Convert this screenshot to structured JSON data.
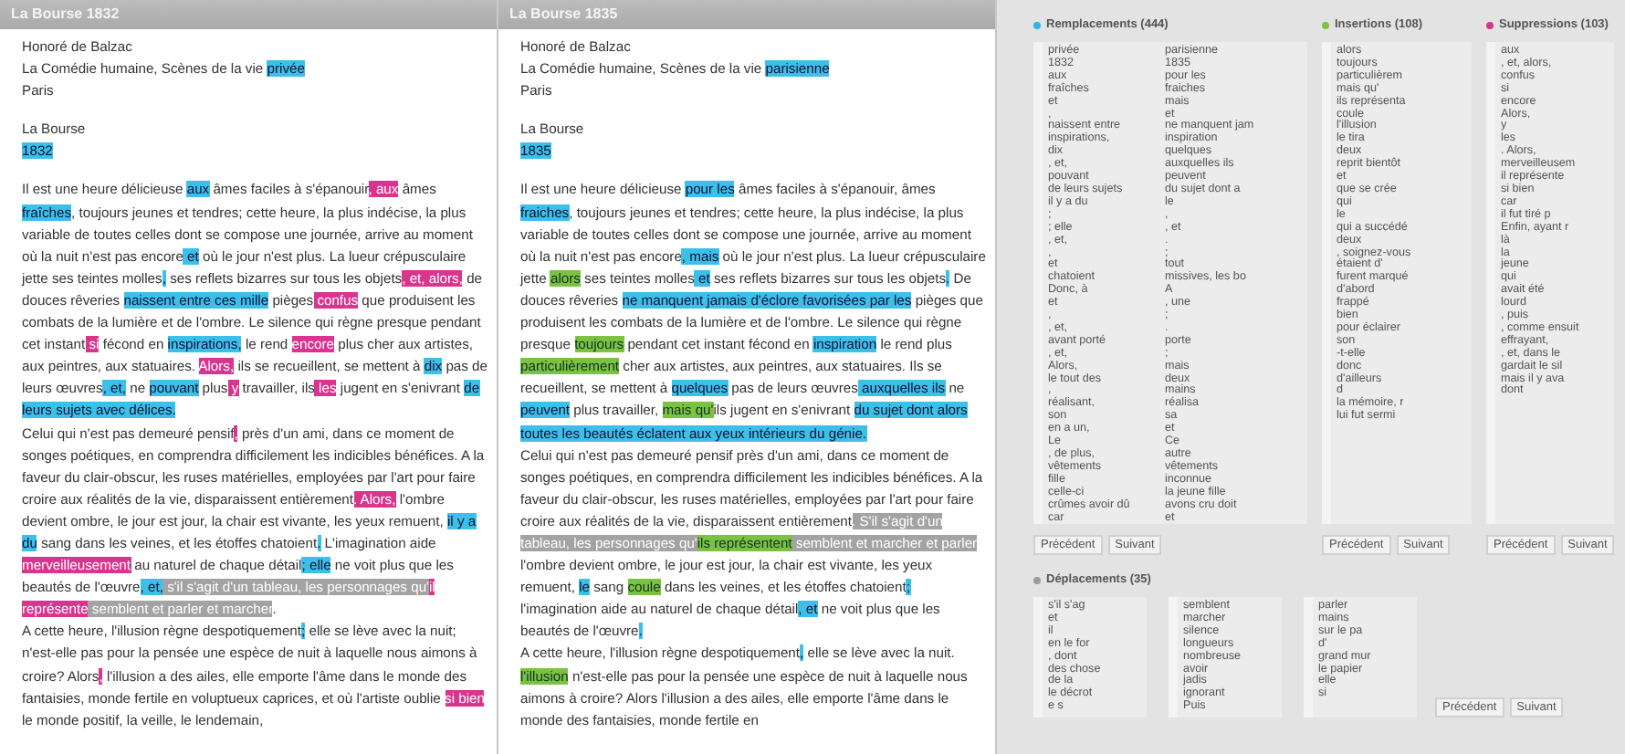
{
  "panels": [
    {
      "title": "La Bourse 1832",
      "meta": [
        [
          {
            "text": "Honoré de Balzac",
            "kind": "plain"
          }
        ],
        [
          {
            "text": "La Comédie humaine, Scènes de la vie ",
            "kind": "plain"
          },
          {
            "text": "privée",
            "kind": "replaced"
          }
        ],
        [
          {
            "text": "Paris",
            "kind": "plain"
          }
        ]
      ],
      "heading": [
        [
          {
            "text": "La Bourse",
            "kind": "plain"
          }
        ],
        [
          {
            "text": "1832",
            "kind": "replaced"
          }
        ]
      ],
      "paragraphs": [
        [
          {
            "text": "Il est une heure délicieuse ",
            "kind": "plain"
          },
          {
            "text": "aux",
            "kind": "replaced"
          },
          {
            "text": " âmes faciles à s'épanouir",
            "kind": "plain"
          },
          {
            "text": ", aux",
            "kind": "deleted"
          },
          {
            "text": " âmes ",
            "kind": "plain"
          },
          {
            "text": "fraîches",
            "kind": "replaced"
          },
          {
            "text": ", toujours jeunes et tendres; cette heure, la plus indécise, la plus variable de toutes celles dont se compose une journée, arrive au moment où la nuit n'est pas encore",
            "kind": "plain"
          },
          {
            "text": " et",
            "kind": "replaced"
          },
          {
            "text": " où le jour n'est plus. La lueur crépusculaire jette ses teintes molles",
            "kind": "plain"
          },
          {
            "text": ",",
            "kind": "replaced"
          },
          {
            "text": " ses reflets bizarres sur tous les objets",
            "kind": "plain"
          },
          {
            "text": ", et, alors,",
            "kind": "deleted"
          },
          {
            "text": " de douces rêveries ",
            "kind": "plain"
          },
          {
            "text": "naissent entre ces mille",
            "kind": "replaced"
          },
          {
            "text": " pièges",
            "kind": "plain"
          },
          {
            "text": " confus",
            "kind": "deleted"
          },
          {
            "text": " que produisent les combats de la lumière et de l'ombre. Le silence qui règne presque pendant cet instant",
            "kind": "plain"
          },
          {
            "text": " si",
            "kind": "deleted"
          },
          {
            "text": " fécond en ",
            "kind": "plain"
          },
          {
            "text": "inspirations,",
            "kind": "replaced"
          },
          {
            "text": " le rend ",
            "kind": "plain"
          },
          {
            "text": "encore",
            "kind": "deleted"
          },
          {
            "text": " plus cher aux artistes, aux peintres, aux statuaires. ",
            "kind": "plain"
          },
          {
            "text": "Alors,",
            "kind": "deleted"
          },
          {
            "text": " ils se recueillent, se mettent à ",
            "kind": "plain"
          },
          {
            "text": "dix",
            "kind": "replaced"
          },
          {
            "text": " pas de leurs œuvres",
            "kind": "plain"
          },
          {
            "text": ", et,",
            "kind": "replaced"
          },
          {
            "text": " ne ",
            "kind": "plain"
          },
          {
            "text": "pouvant",
            "kind": "replaced"
          },
          {
            "text": " plus",
            "kind": "plain"
          },
          {
            "text": " y",
            "kind": "deleted"
          },
          {
            "text": " travailler, ils",
            "kind": "plain"
          },
          {
            "text": " les",
            "kind": "deleted"
          },
          {
            "text": " jugent en s'enivrant ",
            "kind": "plain"
          },
          {
            "text": "de leurs sujets avec délices.",
            "kind": "replaced"
          }
        ],
        [
          {
            "text": "Celui qui n'est pas demeuré pensif",
            "kind": "plain"
          },
          {
            "text": ",",
            "kind": "deleted"
          },
          {
            "text": " près d'un ami, dans ce moment de songes poétiques, en comprendra difficilement les indicibles bénéfices. A la faveur du clair-obscur, les ruses matérielles, employées par l'art pour faire croire aux réalités de la vie, disparaissent entièrement",
            "kind": "plain"
          },
          {
            "text": ". Alors,",
            "kind": "deleted"
          },
          {
            "text": " l'ombre devient ombre, le jour est jour, la chair est vivante, les yeux remuent, ",
            "kind": "plain"
          },
          {
            "text": "il y a du",
            "kind": "replaced"
          },
          {
            "text": " sang dans les veines, et les étoffes chatoient",
            "kind": "plain"
          },
          {
            "text": ".",
            "kind": "replaced"
          },
          {
            "text": " L'imagination aide ",
            "kind": "plain"
          },
          {
            "text": "merveilleusement",
            "kind": "deleted"
          },
          {
            "text": " au naturel de chaque détail",
            "kind": "plain"
          },
          {
            "text": "; elle",
            "kind": "replaced"
          },
          {
            "text": " ne voit plus que les beautés de l'œuvre",
            "kind": "plain"
          },
          {
            "text": ", et,",
            "kind": "replaced"
          },
          {
            "text": " s'il s'agit d'un tableau, les personnages qu'",
            "kind": "moved"
          },
          {
            "text": "il représente",
            "kind": "deleted"
          },
          {
            "text": " semblent et parler et marcher",
            "kind": "moved"
          },
          {
            "text": ".",
            "kind": "plain"
          }
        ],
        [
          {
            "text": "A cette heure, l'illusion règne despotiquement",
            "kind": "plain"
          },
          {
            "text": ";",
            "kind": "replaced"
          },
          {
            "text": " elle se lève avec la nuit; n'est-elle pas pour la pensée une espèce de nuit à laquelle nous aimons à croire? Alors",
            "kind": "plain"
          },
          {
            "text": ",",
            "kind": "deleted"
          },
          {
            "text": " l'illusion a des ailes, elle emporte l'âme dans le monde des fantaisies, monde fertile en voluptueux caprices, et où l'artiste oublie ",
            "kind": "plain"
          },
          {
            "text": "si bien",
            "kind": "deleted"
          },
          {
            "text": " le monde positif, la veille, le lendemain,",
            "kind": "plain"
          }
        ]
      ]
    },
    {
      "title": "La Bourse 1835",
      "meta": [
        [
          {
            "text": "Honoré de Balzac",
            "kind": "plain"
          }
        ],
        [
          {
            "text": "La Comédie humaine, Scènes de la vie ",
            "kind": "plain"
          },
          {
            "text": "parisienne",
            "kind": "replaced"
          }
        ],
        [
          {
            "text": "Paris",
            "kind": "plain"
          }
        ]
      ],
      "heading": [
        [
          {
            "text": "La Bourse",
            "kind": "plain"
          }
        ],
        [
          {
            "text": "1835",
            "kind": "replaced"
          }
        ]
      ],
      "paragraphs": [
        [
          {
            "text": "Il est une heure délicieuse ",
            "kind": "plain"
          },
          {
            "text": "pour les",
            "kind": "replaced"
          },
          {
            "text": " âmes faciles à s'épanouir, âmes ",
            "kind": "plain"
          },
          {
            "text": "fraiches",
            "kind": "replaced"
          },
          {
            "text": ", toujours jeunes et tendres; cette heure, la plus indécise, la plus variable de toutes celles dont se compose une journée, arrive au moment où la nuit n'est pas encore",
            "kind": "plain"
          },
          {
            "text": ", mais",
            "kind": "replaced"
          },
          {
            "text": " où le jour n'est plus. La lueur crépusculaire jette ",
            "kind": "plain"
          },
          {
            "text": "alors",
            "kind": "inserted"
          },
          {
            "text": " ses teintes molles",
            "kind": "plain"
          },
          {
            "text": " et",
            "kind": "replaced"
          },
          {
            "text": " ses reflets bizarres sur tous les objets",
            "kind": "plain"
          },
          {
            "text": ".",
            "kind": "replaced"
          },
          {
            "text": " De douces rêveries ",
            "kind": "plain"
          },
          {
            "text": "ne manquent jamais d'éclore favorisées par les",
            "kind": "replaced"
          },
          {
            "text": " pièges que produisent les combats de la lumière et de l'ombre. Le silence qui règne presque ",
            "kind": "plain"
          },
          {
            "text": "toujours",
            "kind": "inserted"
          },
          {
            "text": " pendant cet instant fécond en ",
            "kind": "plain"
          },
          {
            "text": "inspiration",
            "kind": "replaced"
          },
          {
            "text": " le rend plus ",
            "kind": "plain"
          },
          {
            "text": "particulièrement",
            "kind": "inserted"
          },
          {
            "text": " cher aux artistes, aux peintres, aux statuaires. Ils se recueillent, se mettent à ",
            "kind": "plain"
          },
          {
            "text": "quelques",
            "kind": "replaced"
          },
          {
            "text": " pas de leurs œuvres",
            "kind": "plain"
          },
          {
            "text": " auxquelles ils",
            "kind": "replaced"
          },
          {
            "text": " ne ",
            "kind": "plain"
          },
          {
            "text": "peuvent",
            "kind": "replaced"
          },
          {
            "text": " plus travailler, ",
            "kind": "plain"
          },
          {
            "text": "mais qu'",
            "kind": "inserted"
          },
          {
            "text": "ils jugent en s'enivrant ",
            "kind": "plain"
          },
          {
            "text": "du sujet dont alors toutes les beautés éclatent aux yeux intérieurs du génie.",
            "kind": "replaced"
          }
        ],
        [
          {
            "text": "Celui qui n'est pas demeuré pensif près d'un ami, dans ce moment de songes poétiques, en comprendra difficilement les indicibles bénéfices. A la faveur du clair-obscur, les ruses matérielles, employées par l'art pour faire croire aux réalités de la vie, disparaissent entièrement",
            "kind": "plain"
          },
          {
            "text": ". S'il s'agit d'un tableau, les personnages qu'",
            "kind": "moved"
          },
          {
            "text": "ils représentent",
            "kind": "inserted"
          },
          {
            "text": " semblent et marcher et parler",
            "kind": "moved"
          },
          {
            "text": " l'ombre devient ombre, le jour est jour, la chair est vivante, les yeux remuent, ",
            "kind": "plain"
          },
          {
            "text": "le",
            "kind": "replaced"
          },
          {
            "text": " sang ",
            "kind": "plain"
          },
          {
            "text": "coule",
            "kind": "inserted"
          },
          {
            "text": " dans les veines, et les étoffes chatoient",
            "kind": "plain"
          },
          {
            "text": ";",
            "kind": "replaced"
          },
          {
            "text": " l'imagination aide au naturel de chaque détail",
            "kind": "plain"
          },
          {
            "text": ", et",
            "kind": "replaced"
          },
          {
            "text": " ne voit plus que les beautés de l'œuvre",
            "kind": "plain"
          },
          {
            "text": ".",
            "kind": "replaced"
          }
        ],
        [
          {
            "text": "A cette heure, l'illusion règne despotiquement",
            "kind": "plain"
          },
          {
            "text": ",",
            "kind": "replaced"
          },
          {
            "text": " elle se lève avec la nuit. ",
            "kind": "plain"
          },
          {
            "text": "l'illusion",
            "kind": "inserted"
          },
          {
            "text": " n'est-elle pas pour la pensée une espèce de nuit à laquelle nous aimons à croire? Alors l'illusion a des ailes, elle emporte l'âme dans le monde des fantaisies, monde fertile en",
            "kind": "plain"
          }
        ]
      ]
    }
  ],
  "changes": [
    {
      "title": "Remplacements (444)",
      "color": "#29b6e8",
      "kind": "pairs",
      "rows": [
        [
          "privée",
          "parisienne"
        ],
        [
          "1832",
          "1835"
        ],
        [
          "aux",
          "pour les"
        ],
        [
          "fraîches",
          "fraiches"
        ],
        [
          "et",
          "mais"
        ],
        [
          ",",
          "et"
        ],
        [
          "naissent entre",
          "ne manquent jam"
        ],
        [
          "inspirations,",
          "inspiration"
        ],
        [
          "dix",
          "quelques"
        ],
        [
          ", et,",
          "auxquelles ils"
        ],
        [
          "pouvant",
          "peuvent"
        ],
        [
          "de leurs sujets",
          "du sujet dont a"
        ],
        [
          "il y a du",
          "le"
        ],
        [
          ";",
          ","
        ],
        [
          "; elle",
          ", et"
        ],
        [
          ", et,",
          "."
        ],
        [
          ",",
          ";"
        ],
        [
          "et",
          "tout"
        ],
        [
          "chatoient",
          "missives, les bo"
        ],
        [
          "Donc, à",
          "A"
        ],
        [
          "et",
          ", une"
        ],
        [
          ",",
          ";"
        ],
        [
          ", et,",
          "."
        ],
        [
          "avant porté",
          "porte"
        ],
        [
          ", et,",
          ";"
        ],
        [
          "Alors,",
          "mais"
        ],
        [
          "le tout des",
          "deux"
        ],
        [
          ",",
          "mains"
        ],
        [
          "réalisant,",
          "réalisa"
        ],
        [
          "son",
          "sa"
        ],
        [
          "en a un,",
          "et"
        ],
        [
          "Le",
          "Ce"
        ],
        [
          ", de plus,",
          "autre"
        ],
        [
          "vêtements",
          "vêtements"
        ],
        [
          "fille",
          "inconnue"
        ],
        [
          "celle-ci",
          "la jeune fille"
        ],
        [
          "crûmes avoir dû",
          "avons cru doit"
        ],
        [
          "car",
          "et"
        ]
      ],
      "buttons": [
        "Précédent",
        "Suivant"
      ]
    },
    {
      "title": "Insertions (108)",
      "color": "#7cc242",
      "kind": "single",
      "rows": [
        "alors",
        "toujours",
        "particulièrem",
        "mais qu'",
        "ils représenta",
        "coule",
        "l'illusion",
        "le tira",
        "deux",
        "reprit bientôt",
        "et",
        "que se crée",
        "qui",
        "le",
        "qui a succédé",
        "deux",
        ", soignez-vous",
        "étaient d'",
        "furent marqué",
        "d'abord",
        "frappé",
        "bien",
        "pour éclairer",
        "son",
        "-t-elle",
        "donc",
        "d'ailleurs",
        "d",
        "la mémoire, r",
        "lui fut sermi"
      ],
      "buttons": [
        "Précédent",
        "Suivant"
      ]
    },
    {
      "title": "Suppressions (103)",
      "color": "#d9358f",
      "kind": "single",
      "rows": [
        "aux",
        ", et, alors,",
        "confus",
        "si",
        "encore",
        "Alors,",
        "y",
        "les",
        ". Alors,",
        "merveilleusem",
        "il représente",
        "si bien",
        "car",
        "il fut tiré p",
        "Enfin, ayant r",
        "là",
        "la",
        "jeune",
        "qui",
        "avait été",
        "lourd",
        ", puis",
        ", comme ensuit",
        "effrayant,",
        ", et, dans le",
        "gardait le sil",
        "mais il y ava",
        "dont"
      ],
      "buttons": [
        "Précédent",
        "Suivant"
      ]
    }
  ],
  "moves": {
    "title": "Déplacements (35)",
    "color": "#9a9a9a",
    "columns": [
      [
        "s'il s'ag",
        "et",
        "il",
        "en le for",
        ", dont",
        "des chose",
        "de la",
        "le décrot",
        "e s"
      ],
      [
        "semblent",
        "marcher",
        "silence",
        "longueurs",
        "nombreuse",
        "avoir",
        "jadis",
        "ignorant",
        "Puis"
      ],
      [
        "parler",
        "mains",
        "sur le pa",
        "d'",
        "grand mur",
        "le papier",
        "elle",
        "si"
      ]
    ],
    "buttons": [
      "Précédent",
      "Suivant"
    ]
  }
}
